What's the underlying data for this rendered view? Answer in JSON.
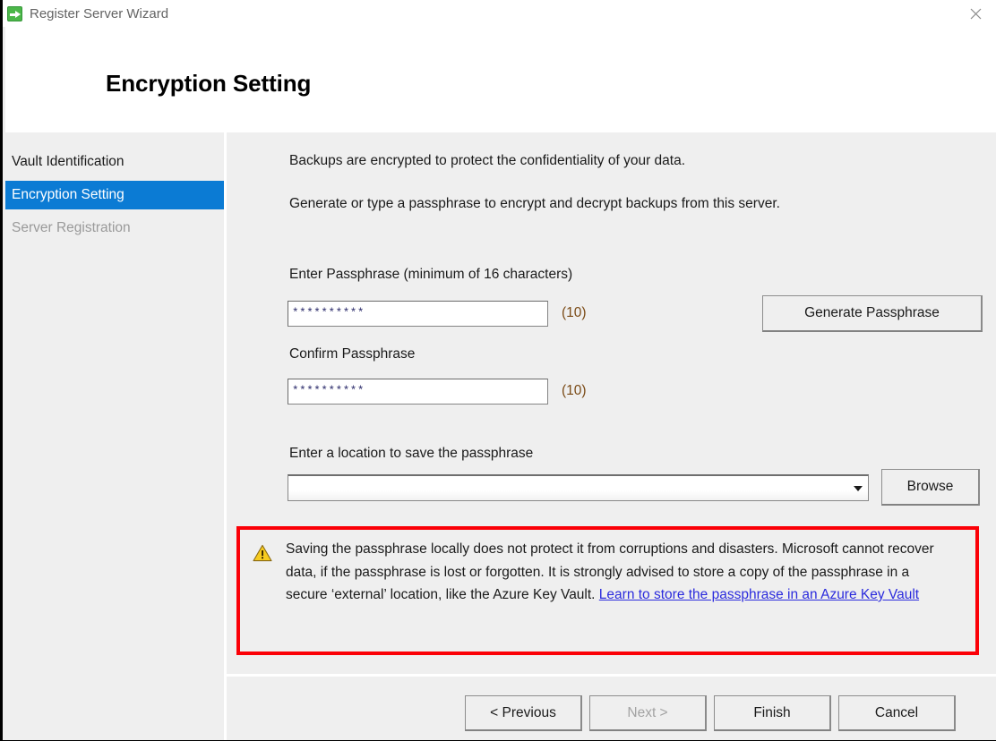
{
  "window": {
    "title": "Register Server Wizard",
    "icon": "green-arrow-icon",
    "close_label": "✕"
  },
  "header": {
    "page_title": "Encryption Setting"
  },
  "sidebar": {
    "items": [
      {
        "label": "Vault Identification",
        "state": "normal"
      },
      {
        "label": "Encryption Setting",
        "state": "selected"
      },
      {
        "label": "Server Registration",
        "state": "disabled"
      }
    ]
  },
  "content": {
    "intro_line_1": "Backups are encrypted to protect the confidentiality of your data.",
    "intro_line_2": "Generate or type a passphrase to encrypt and decrypt backups from this server.",
    "enter_passphrase": {
      "label": "Enter Passphrase (minimum of 16 characters)",
      "value": "**********",
      "count": "(10)"
    },
    "confirm_passphrase": {
      "label": "Confirm Passphrase",
      "value": "**********",
      "count": "(10)"
    },
    "generate_button": "Generate Passphrase",
    "location": {
      "label": "Enter a location to save the passphrase",
      "value": "",
      "placeholder": "",
      "browse_button": "Browse"
    },
    "warning": {
      "icon": "warning-triangle-icon",
      "text": "Saving the passphrase locally does not protect it from corruptions and disasters. Microsoft cannot recover data, if the passphrase is lost or forgotten. It is strongly advised to store a copy of the passphrase in a secure ‘external’ location, like the Azure Key Vault. ",
      "link_text": "Learn to store the passphrase in an Azure Key Vault",
      "border_color": "#fb0007",
      "link_color": "#2b2bdd"
    }
  },
  "footer": {
    "previous": "< Previous",
    "next": "Next >",
    "finish": "Finish",
    "cancel": "Cancel"
  },
  "colors": {
    "accent": "#0b7bd4",
    "window_bg": "#efefef",
    "header_bg": "#ffffff",
    "warning_border": "#fb0007",
    "link": "#2b2bdd"
  }
}
